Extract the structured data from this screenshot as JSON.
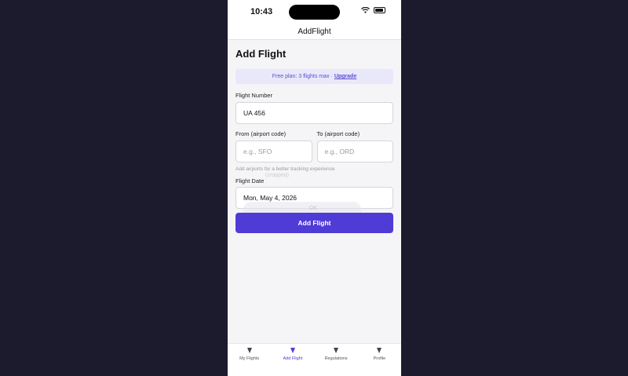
{
  "status_bar": {
    "time": "10:43",
    "wifi_icon": "wifi-icon",
    "battery_icon": "battery-icon"
  },
  "nav": {
    "title": "AddFlight"
  },
  "page": {
    "title": "Add Flight"
  },
  "banner": {
    "text": "Free plan: 3 flights max · ",
    "link": "Upgrade"
  },
  "form": {
    "flight_number": {
      "label": "Flight Number",
      "value": "UA 456"
    },
    "from": {
      "label": "From (airport code)",
      "placeholder": "e.g., SFO"
    },
    "to": {
      "label": "To (airport code)",
      "placeholder": "e.g., ORD"
    },
    "hint": "Add airports for a better tracking experience",
    "date": {
      "label": "Flight Date",
      "value": "Mon, May 4, 2026"
    },
    "submit": "Add Flight"
  },
  "ghost": {
    "text1": "(cropped)",
    "text2": "OK"
  },
  "tabs": [
    {
      "label": "My Flights",
      "icon": "triangle-icon",
      "active": false
    },
    {
      "label": "Add Flight",
      "icon": "triangle-icon",
      "active": true
    },
    {
      "label": "Regulations",
      "icon": "triangle-icon",
      "active": false
    },
    {
      "label": "Profile",
      "icon": "triangle-icon",
      "active": false
    }
  ],
  "colors": {
    "accent": "#4f3bd6",
    "banner_bg": "#e9e8fb",
    "background": "#1c1b2e"
  }
}
